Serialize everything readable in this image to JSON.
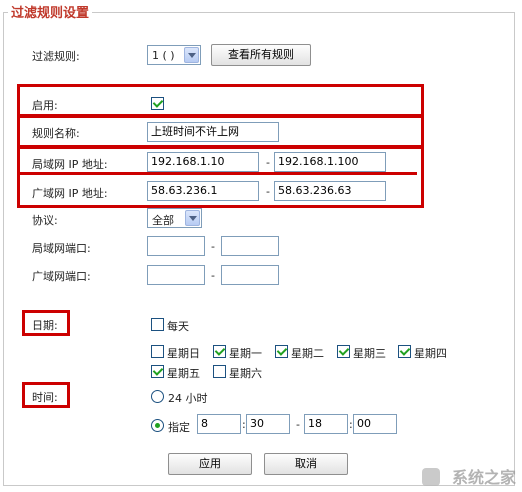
{
  "section_title": "过滤规则设置",
  "filter_rule": {
    "label": "过滤规则:",
    "selected": "1 ( )",
    "view_all_button": "查看所有规则"
  },
  "enable": {
    "label": "启用:",
    "checked": true
  },
  "rule_name": {
    "label": "规则名称:",
    "value": "上班时间不许上网"
  },
  "lan_ip": {
    "label": "局域网  IP 地址:",
    "start": "192.168.1.10",
    "end": "192.168.1.100"
  },
  "wan_ip": {
    "label": "广域网  IP 地址:",
    "start": "58.63.236.1",
    "end": "58.63.236.63"
  },
  "protocol": {
    "label": "协议:",
    "selected": "全部"
  },
  "lan_port": {
    "label": "局域网端口:",
    "start": "",
    "end": ""
  },
  "wan_port": {
    "label": "广域网端口:",
    "start": "",
    "end": ""
  },
  "range_dash": "-",
  "date": {
    "label": "日期:",
    "everyday": {
      "label": "每天",
      "checked": false
    },
    "days": [
      {
        "label": "星期日",
        "checked": false
      },
      {
        "label": "星期一",
        "checked": true
      },
      {
        "label": "星期二",
        "checked": true
      },
      {
        "label": "星期三",
        "checked": true
      },
      {
        "label": "星期四",
        "checked": true
      },
      {
        "label": "星期五",
        "checked": true
      },
      {
        "label": "星期六",
        "checked": false
      }
    ]
  },
  "time": {
    "label": "时间:",
    "all_day": {
      "label": "24 小时",
      "selected": false
    },
    "specify": {
      "label": "指定",
      "selected": true,
      "start_hour": "8",
      "start_minute": "30",
      "end_hour": "18",
      "end_minute": "00",
      "colon": ":"
    }
  },
  "buttons": {
    "apply": "应用",
    "cancel": "取消"
  },
  "watermark": "系统之家",
  "colors": {
    "highlight": "#cc0000",
    "title": "#c0392b",
    "check": "#21a121"
  }
}
